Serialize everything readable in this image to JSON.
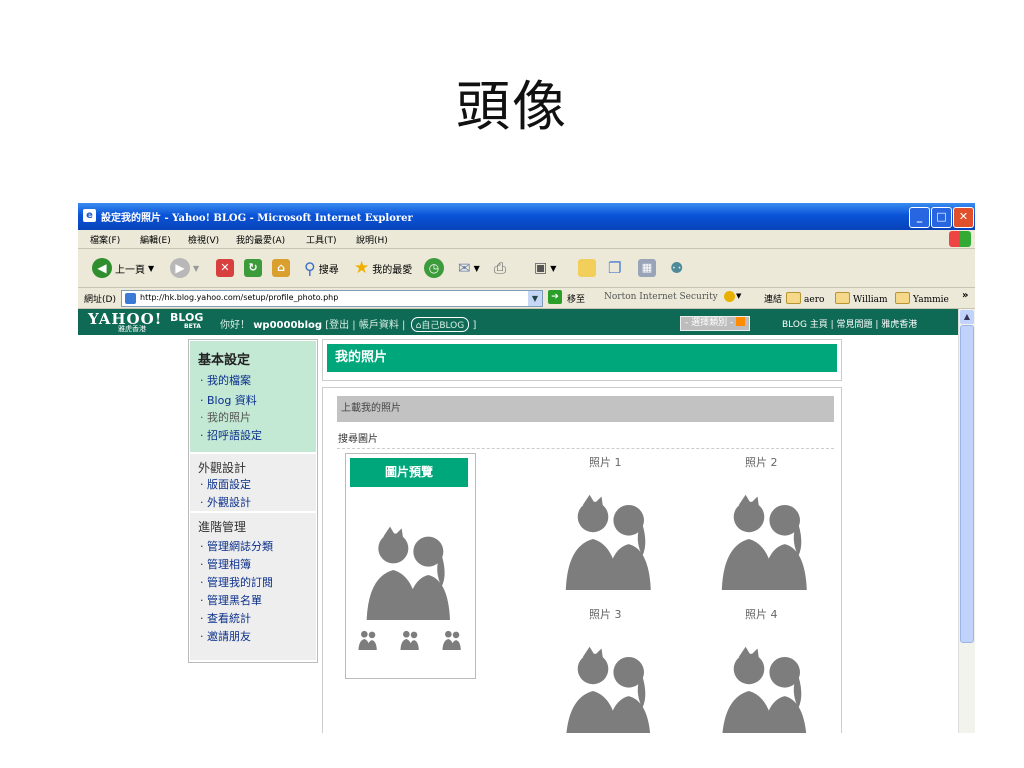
{
  "slide": {
    "title": "頭像"
  },
  "window": {
    "title": "設定我的照片 - Yahoo! BLOG - Microsoft Internet Explorer"
  },
  "menu": [
    "檔案(F)",
    "編輯(E)",
    "檢視(V)",
    "我的最愛(A)",
    "工具(T)",
    "說明(H)"
  ],
  "toolbar": {
    "back_label": "上一頁",
    "search_label": "搜尋",
    "favorites_label": "我的最愛"
  },
  "address": {
    "label": "網址(D)",
    "url": "http://hk.blog.yahoo.com/setup/profile_photo.php",
    "go_label": "移至",
    "norton": "Norton Internet Security",
    "links_label": "連結",
    "links": [
      "aero",
      "William",
      "Yammie"
    ]
  },
  "header": {
    "logo": "YAHOO!",
    "logo_sub": "雅虎香港",
    "blog": "BLOG",
    "beta": "BETA",
    "greeting": "你好！",
    "username": "wp0000blog",
    "links_text": "[登出 | 帳戶資料 |",
    "my_blog": "自己BLOG",
    "links_end": "]",
    "category_select": "- 選擇類別 -",
    "right_links": "BLOG 主頁 | 常見問題 | 雅虎香港"
  },
  "sidebar": {
    "sections": [
      {
        "heading": "基本設定",
        "items": [
          "我的檔案",
          "Blog 資料",
          "我的照片",
          "招呼語設定"
        ]
      },
      {
        "heading": "外觀設計",
        "items": [
          "版面設定",
          "外觀設計"
        ]
      },
      {
        "heading": "進階管理",
        "items": [
          "管理網誌分類",
          "管理相簿",
          "管理我的訂閱",
          "管理黑名單",
          "查看統計",
          "邀請朋友"
        ]
      }
    ]
  },
  "main": {
    "title": "我的照片",
    "upload_label": "上載我的照片",
    "search_label": "搜尋圖片",
    "preview_button": "圖片預覽",
    "photos": [
      "照片 1",
      "照片 2",
      "照片 3",
      "照片 4"
    ]
  },
  "colors": {
    "accent": "#00a77a",
    "header": "#0f6a55",
    "titlebar": "#0a54d8"
  }
}
